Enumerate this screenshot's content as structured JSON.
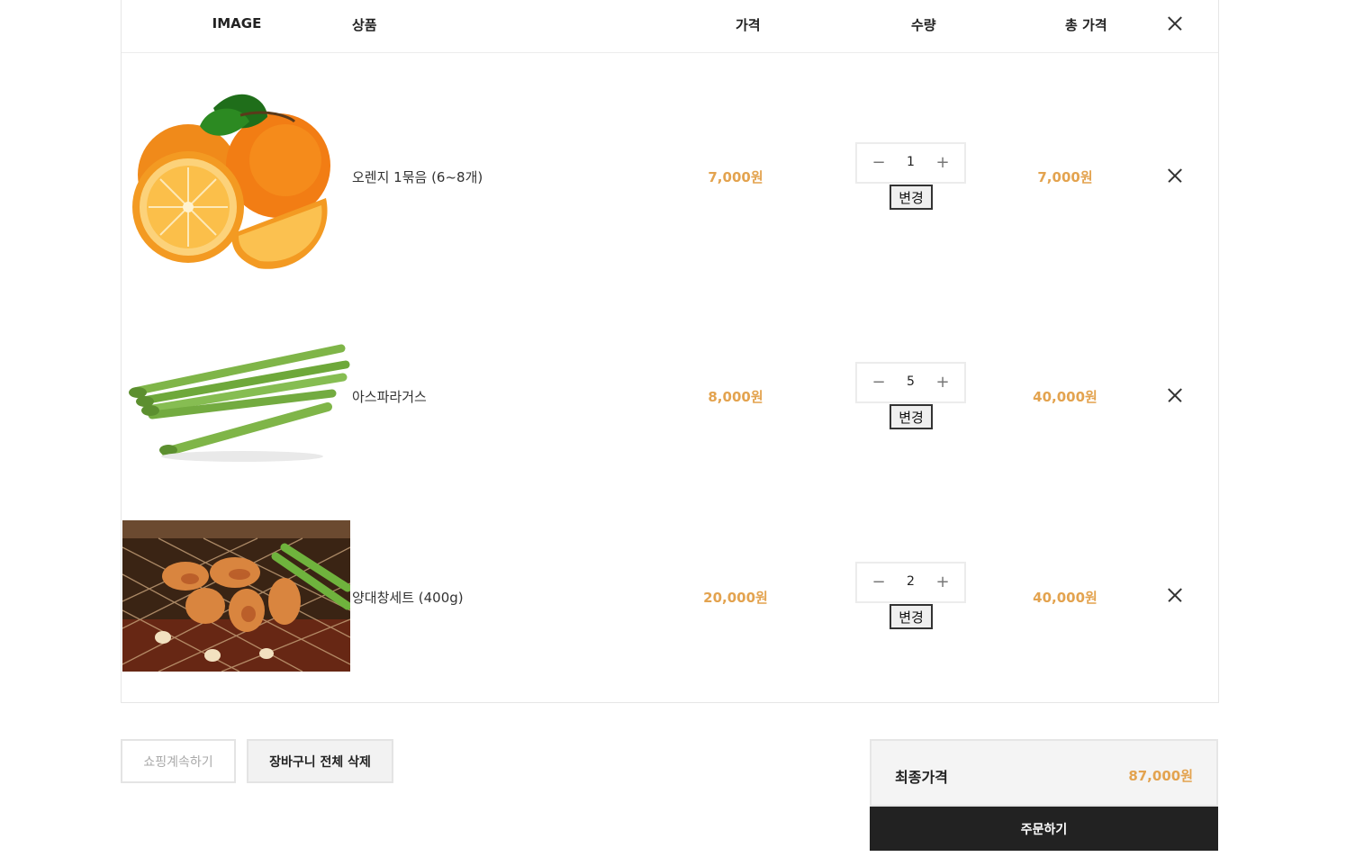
{
  "table": {
    "headers": {
      "image": "IMAGE",
      "product": "상품",
      "price": "가격",
      "quantity": "수량",
      "total": "총 가격"
    },
    "rows": [
      {
        "name": "오렌지 1묶음 (6~8개)",
        "price": "7,000원",
        "quantity": "1",
        "change_label": "변경",
        "total": "7,000원",
        "image_icon": "orange-photo"
      },
      {
        "name": "아스파라거스",
        "price": "8,000원",
        "quantity": "5",
        "change_label": "변경",
        "total": "40,000원",
        "image_icon": "asparagus-photo"
      },
      {
        "name": "양대창세트 (400g)",
        "price": "20,000원",
        "quantity": "2",
        "change_label": "변경",
        "total": "40,000원",
        "image_icon": "grilled-tripe-photo"
      }
    ]
  },
  "actions": {
    "continue_shopping": "쇼핑계속하기",
    "clear_cart": "장바구니 전체 삭제"
  },
  "summary": {
    "label": "최종가격",
    "value": "87,000원",
    "order_button": "주문하기"
  },
  "colors": {
    "price_accent": "#e3a34f",
    "order_button_bg": "#222222"
  }
}
